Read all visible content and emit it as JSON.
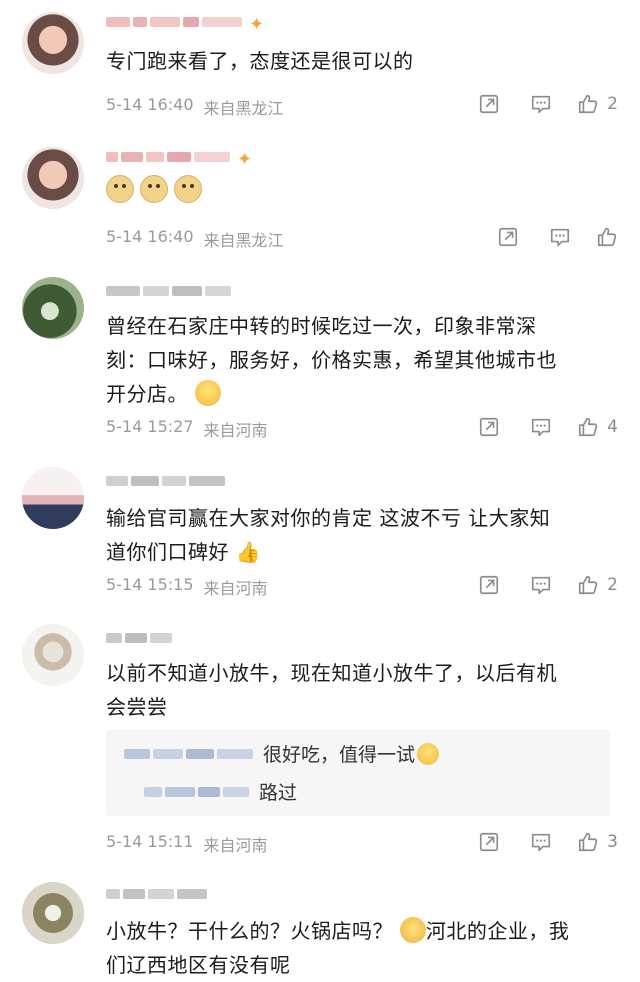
{
  "icons": {
    "share": "share-icon",
    "comment": "comment-icon",
    "like": "thumbs-up-icon"
  },
  "comments": [
    {
      "text": "专门跑来看了，态度还是很可以的",
      "time": "5-14 16:40",
      "location": "来自黑龙江",
      "likes": "2"
    },
    {
      "text": "",
      "time": "5-14 16:40",
      "location": "来自黑龙江",
      "likes": ""
    },
    {
      "text_l1": "曾经在石家庄中转的时候吃过一次，印象非常深",
      "text_l2": "刻：口味好，服务好，价格实惠，希望其他城市也",
      "text_l3": "开分店。",
      "time": "5-14 15:27",
      "location": "来自河南",
      "likes": "4"
    },
    {
      "text_l1": "输给官司赢在大家对你的肯定 这波不亏 让大家知",
      "text_l2": "道你们口碑好",
      "time": "5-14 15:15",
      "location": "来自河南",
      "likes": "2"
    },
    {
      "text_l1": "以前不知道小放牛，现在知道小放牛了，以后有机",
      "text_l2": "会尝尝",
      "replies": [
        "很好吃，值得一试",
        "路过"
      ],
      "time": "5-14 15:11",
      "location": "来自河南",
      "likes": "3"
    },
    {
      "text_l1": "小放牛？干什么的？火锅店吗？",
      "text_l1b": "河北的企业，我",
      "text_l2": "们辽西地区有没有呢"
    }
  ]
}
